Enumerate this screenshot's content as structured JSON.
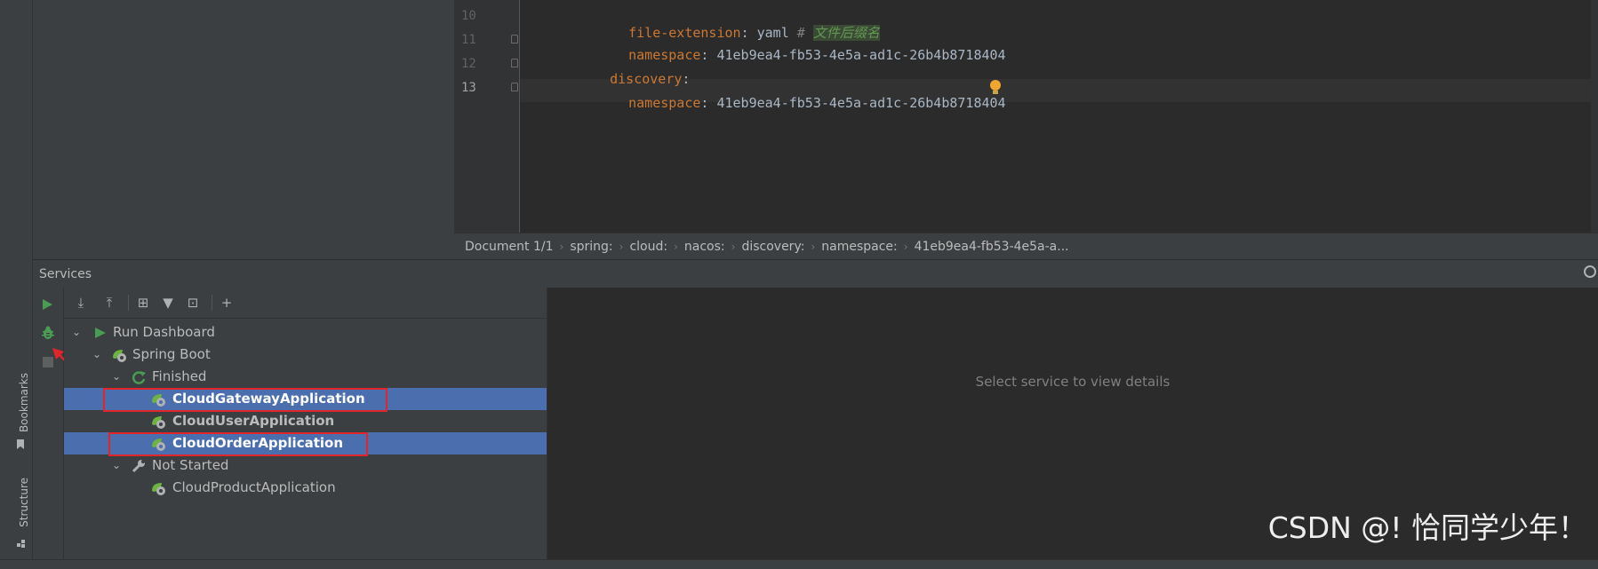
{
  "editor": {
    "lines": [
      {
        "num": "10",
        "key": "file-extension",
        "colon": ":",
        "value": " yaml",
        "hash": " # ",
        "comment": "文件后缀名"
      },
      {
        "num": "11",
        "key": "namespace",
        "colon": ":",
        "value": " 41eb9ea4-fb53-4e5a-ad1c-26b4b8718404"
      },
      {
        "num": "12",
        "key": "discovery",
        "colon": ":"
      },
      {
        "num": "13",
        "key": "namespace",
        "colon": ":",
        "value": " 41eb9ea4-fb53-4e5a-ad1c-26b4b8718404"
      }
    ]
  },
  "breadcrumb": [
    "Document 1/1",
    "spring:",
    "cloud:",
    "nacos:",
    "discovery:",
    "namespace:",
    "41eb9ea4-fb53-4e5a-a..."
  ],
  "services": {
    "title": "Services",
    "empty_details": "Select service to view details",
    "tree": {
      "root": "Run Dashboard",
      "group": "Spring Boot",
      "finished": "Finished",
      "apps_finished": [
        "CloudGatewayApplication",
        "CloudUserApplication",
        "CloudOrderApplication"
      ],
      "not_started": "Not Started",
      "apps_not_started": [
        "CloudProductApplication"
      ]
    }
  },
  "side_tabs": {
    "bookmarks": "Bookmarks",
    "structure": "Structure"
  },
  "watermark": "CSDN @! 恰同学少年！",
  "colors": {
    "selection": "#4b6eaf",
    "highlight_box": "#e0262b",
    "run_green": "#499c54",
    "key_orange": "#cc7832"
  }
}
